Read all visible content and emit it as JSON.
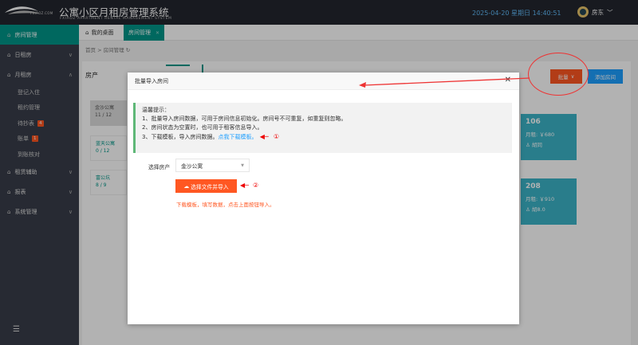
{
  "header": {
    "logo_text": "FXIAOZ.COM",
    "title": "公寓小区月租房管理系统",
    "subtitle": "FXIAOZ APARTMENT RENTAL MANAGEMENT SYSTEM",
    "datetime": "2025-04-20 星期日 14:40:51",
    "user_name": "房东"
  },
  "sidebar": {
    "items": [
      {
        "label": "房间管理"
      },
      {
        "label": "日租房"
      },
      {
        "label": "月租房"
      },
      {
        "label": "租赁辅助"
      },
      {
        "label": "报表"
      },
      {
        "label": "系统管理"
      }
    ],
    "sub_items": [
      {
        "label": "登记入住"
      },
      {
        "label": "租约管理"
      },
      {
        "label": "待抄表",
        "badge": "4"
      },
      {
        "label": "账单",
        "badge": "1"
      },
      {
        "label": "到账核对"
      }
    ]
  },
  "tabs": [
    {
      "label": "我的桌面"
    },
    {
      "label": "房间管理"
    }
  ],
  "breadcrumb": {
    "home": "首页",
    "sep": ">",
    "current": "房间管理"
  },
  "panel": {
    "title": "房产",
    "batch_label": "批量",
    "add_label": "添加房间",
    "apartments": [
      {
        "name": "金沙公寓",
        "count": "11 / 12"
      },
      {
        "name": "蓝天公寓",
        "count": "0 / 12"
      },
      {
        "name": "富公坑",
        "count": "8 / 9"
      }
    ],
    "rooms": [
      {
        "no": "106",
        "rent": "月租: ￥680",
        "tenant": "胡同"
      },
      {
        "no": "208",
        "rent": "月租: ￥910",
        "tenant": "胡8.0"
      }
    ]
  },
  "modal": {
    "title": "批量导入房间",
    "tip_title": "温馨提示：",
    "tip_line1": "1、批量导入房间数据，可用于房间信息初始化。房间号不可重复，如重复则忽略。",
    "tip_line2": "2、房间状态为空置时，也可用于租客信息导入。",
    "tip_line3": "3、下载模板，导入房间数据。",
    "tip_link": "点我下载模板。",
    "form_label": "选择房产",
    "select_value": "金沙公寓",
    "upload_label": "选择文件并导入",
    "hint": "下载模板，填写数据，点击上面按钮导入。"
  },
  "annotations": {
    "mark1": "①",
    "mark2": "②"
  },
  "colors": {
    "teal": "#009688",
    "orange": "#ff5722",
    "blue": "#1e9fff",
    "sidebar": "#393d49",
    "topbar": "#23262e"
  }
}
